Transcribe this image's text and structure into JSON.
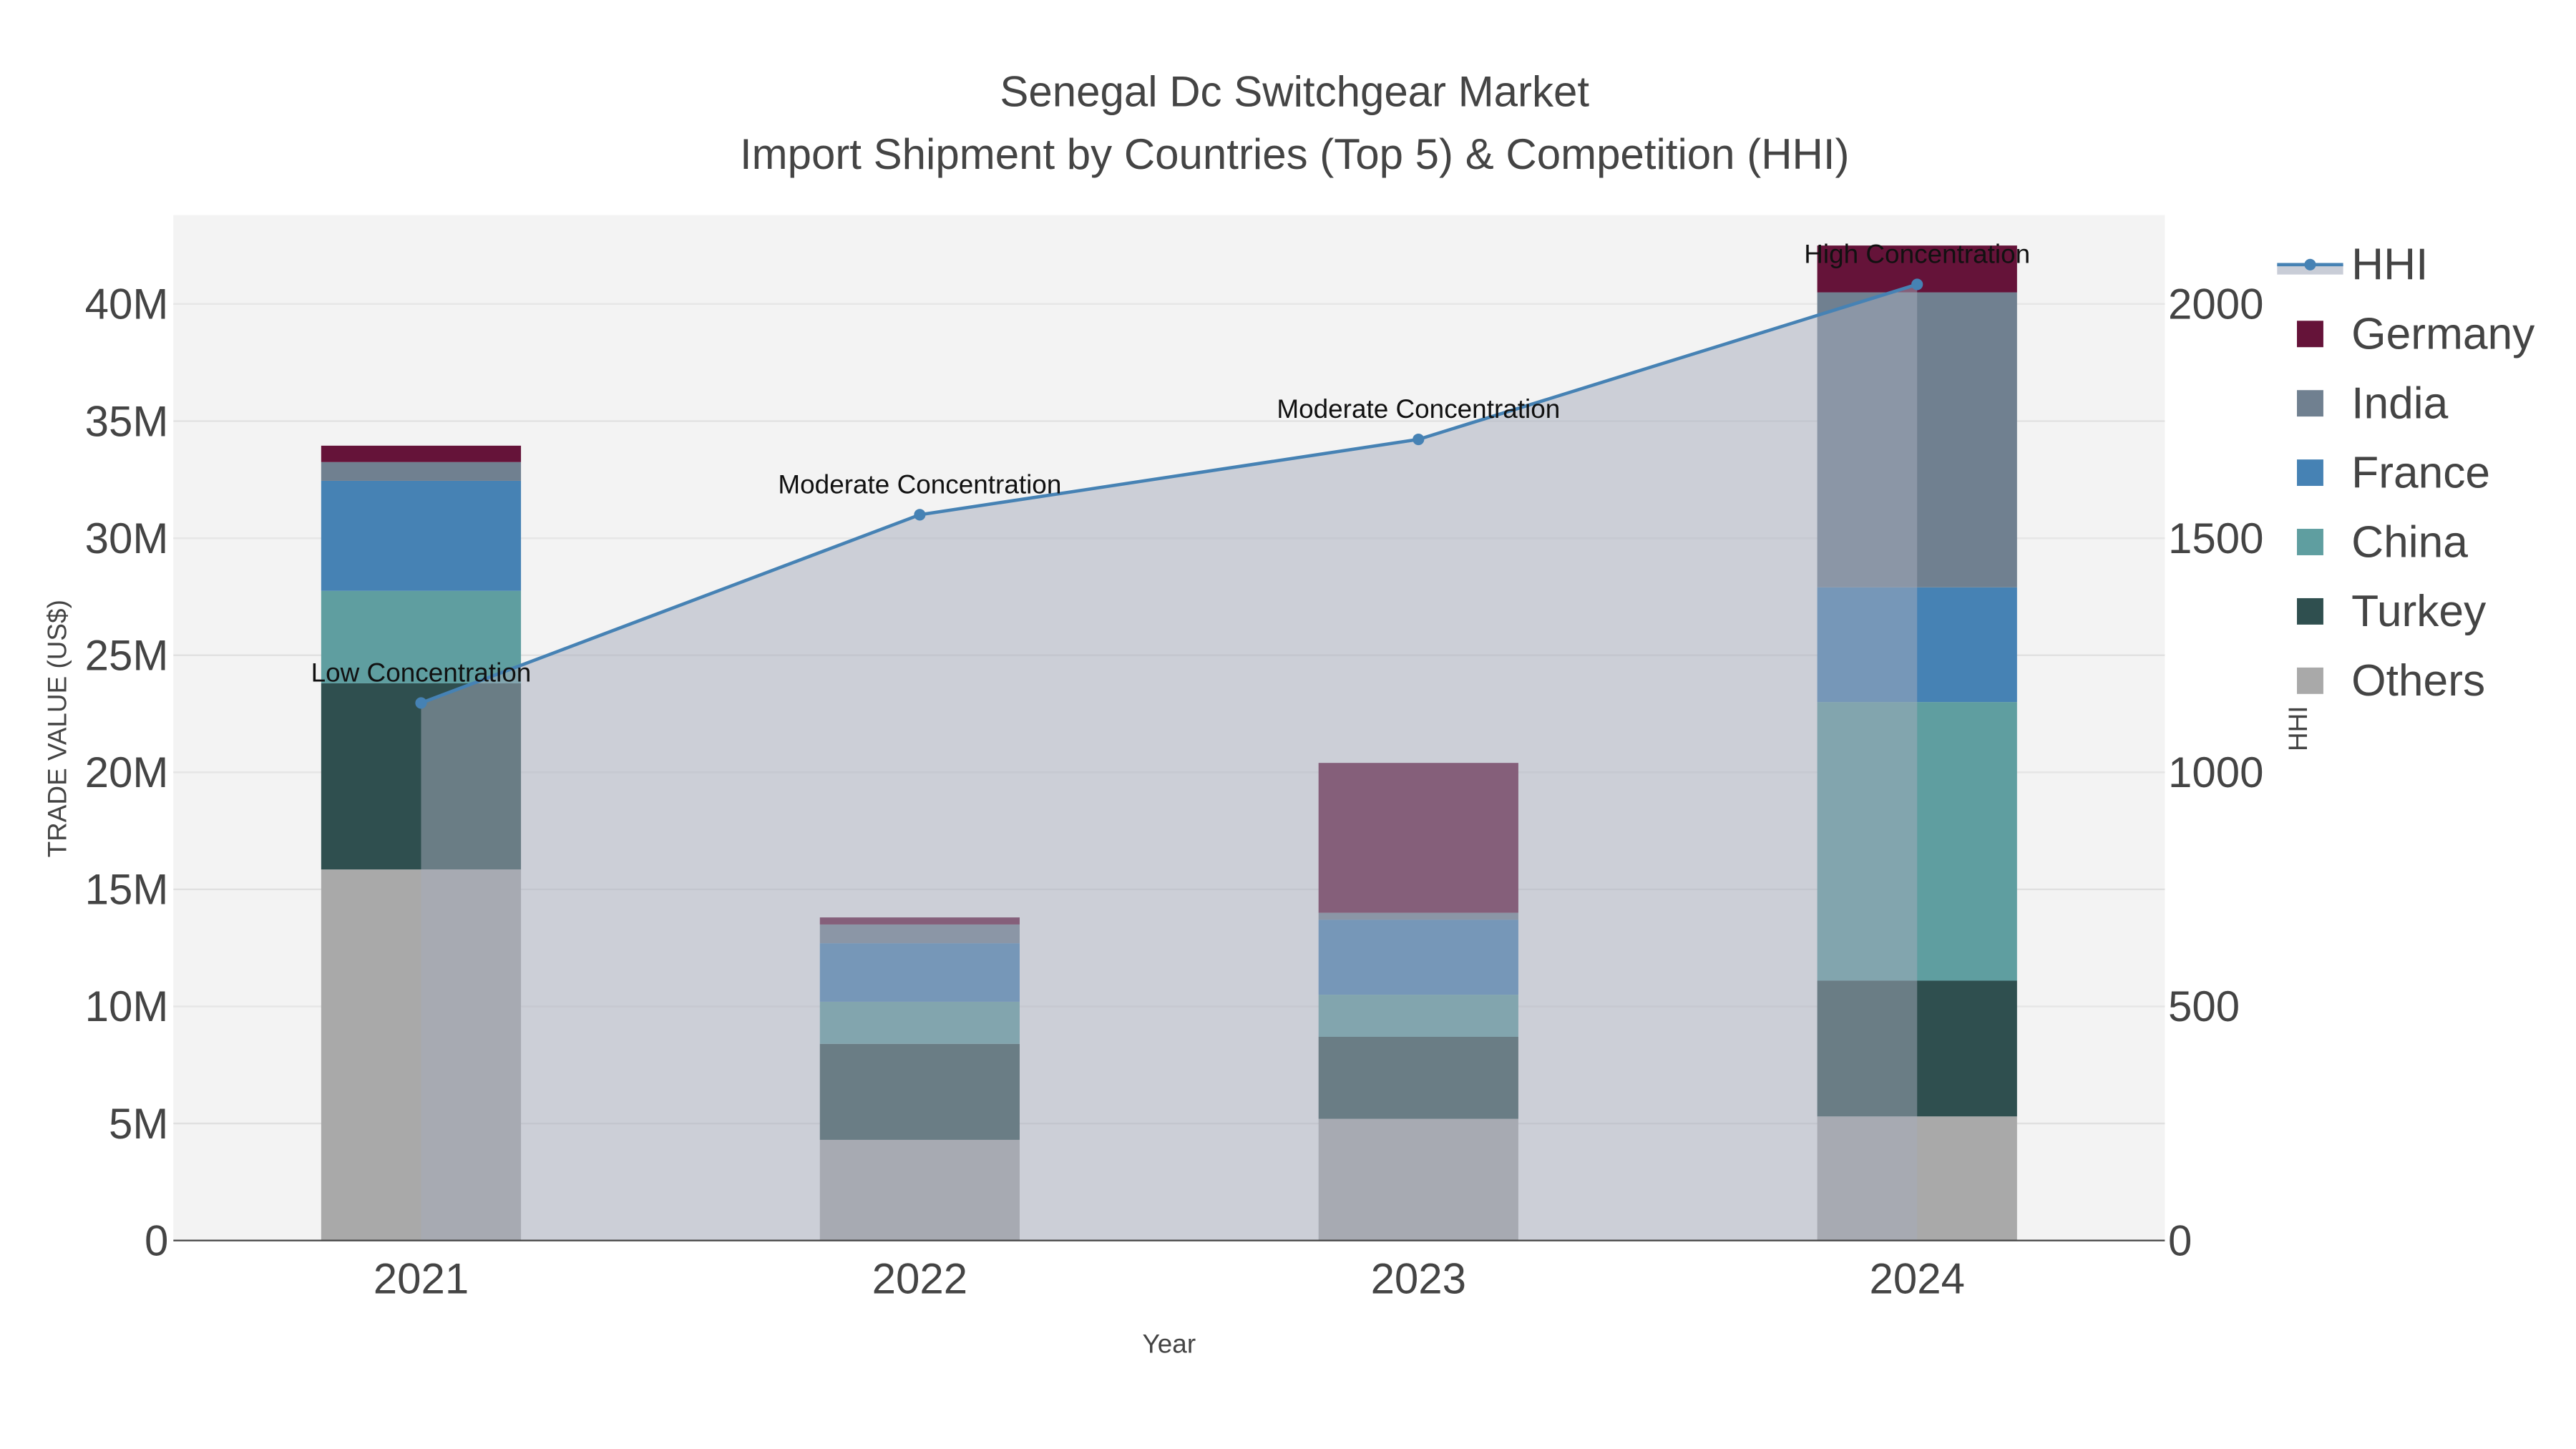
{
  "chart_data": {
    "type": "bar",
    "title": "Senegal Dc Switchgear Market",
    "subtitle": "Import Shipment by Countries (Top 5) & Competition (HHI)",
    "xlabel": "Year",
    "ylabel": "TRADE VALUE (US$)",
    "y2label": "HHI",
    "categories": [
      "2021",
      "2022",
      "2023",
      "2024"
    ],
    "stacked": true,
    "ylim": [
      0,
      43800000
    ],
    "y2lim": [
      0,
      2190
    ],
    "yticks": [
      0,
      5000000,
      10000000,
      15000000,
      20000000,
      25000000,
      30000000,
      35000000,
      40000000
    ],
    "ytick_labels": [
      "0",
      "5M",
      "10M",
      "15M",
      "20M",
      "25M",
      "30M",
      "35M",
      "40M"
    ],
    "y2ticks": [
      0,
      500,
      1000,
      1500,
      2000
    ],
    "y2tick_labels": [
      "0",
      "500",
      "1000",
      "1500",
      "2000"
    ],
    "series": [
      {
        "name": "Others",
        "color": "#a9a9a9",
        "values": [
          15850000,
          4300000,
          5200000,
          5300000
        ]
      },
      {
        "name": "Turkey",
        "color": "#2f4f4f",
        "values": [
          7950000,
          4100000,
          3500000,
          5800000
        ]
      },
      {
        "name": "China",
        "color": "#5f9ea0",
        "values": [
          3950000,
          1800000,
          1800000,
          11900000
        ]
      },
      {
        "name": "France",
        "color": "#4682b4",
        "values": [
          4700000,
          2500000,
          3200000,
          4900000
        ]
      },
      {
        "name": "India",
        "color": "#708090",
        "values": [
          800000,
          800000,
          300000,
          12600000
        ]
      },
      {
        "name": "Germany",
        "color": "#651339",
        "values": [
          700000,
          300000,
          6400000,
          2000000
        ]
      }
    ],
    "line": {
      "name": "HHI",
      "color": "#4682b4",
      "values": [
        1148,
        1550,
        1711,
        2042
      ],
      "annotations": [
        "Low Concentration",
        "Moderate Concentration",
        "Moderate Concentration",
        "High Concentration"
      ]
    },
    "legend_order": [
      "HHI",
      "Germany",
      "India",
      "France",
      "China",
      "Turkey",
      "Others"
    ],
    "legend_position": "right",
    "grid": true
  }
}
